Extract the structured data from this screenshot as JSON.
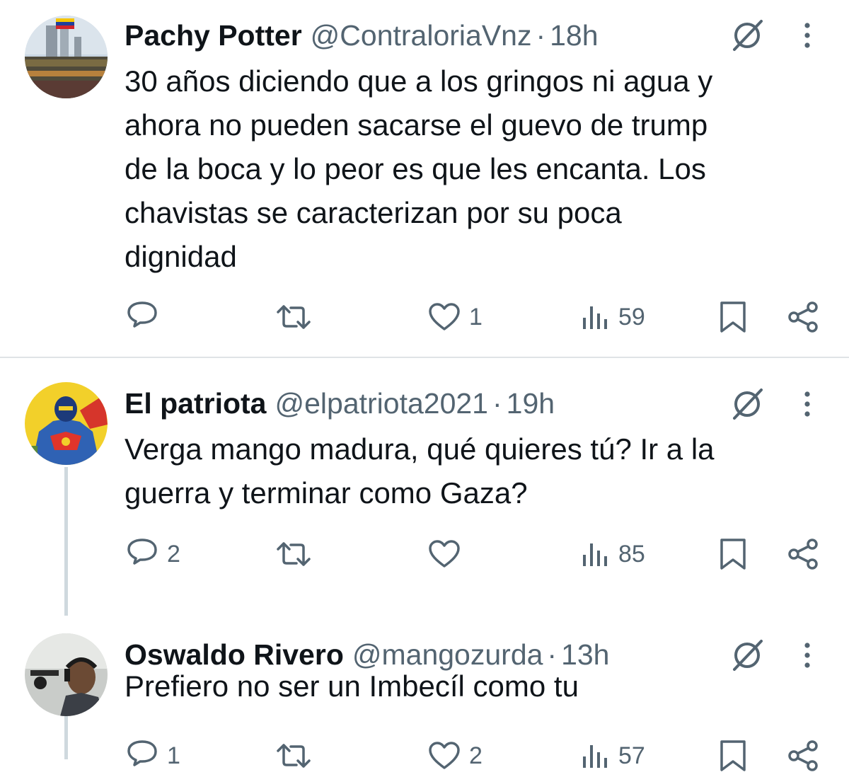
{
  "tweets": [
    {
      "display_name": "Pachy Potter",
      "handle": "@ContraloriaVnz",
      "separator": "·",
      "time": "18h",
      "text": "30 años diciendo que a los gringos ni agua y\nahora no pueden sacarse el guevo de  trump\nde la boca y lo peor es que les encanta. Los\nchavistas se caracterizan por su poca\ndignidad",
      "replies": "",
      "retweets": "",
      "likes": "1",
      "views": "59"
    },
    {
      "display_name": "El patriota",
      "handle": "@elpatriota2021",
      "separator": "·",
      "time": "19h",
      "text": "Verga mango madura, qué quieres tú? Ir a la\nguerra y terminar como Gaza?",
      "replies": "2",
      "retweets": "",
      "likes": "",
      "views": "85"
    },
    {
      "display_name": "Oswaldo Rivero",
      "handle": "@mangozurda",
      "separator": "·",
      "time": "13h",
      "text": "Prefiero no ser un Imbecíl como tu",
      "replies": "1",
      "retweets": "",
      "likes": "2",
      "views": "57"
    }
  ],
  "icons": {
    "grok": "grok-icon",
    "more": "more-vertical-icon",
    "reply": "reply-icon",
    "retweet": "retweet-icon",
    "like": "heart-icon",
    "views": "views-icon",
    "bookmark": "bookmark-icon",
    "share": "share-icon"
  },
  "colors": {
    "text_primary": "#0f1419",
    "text_secondary": "#536471",
    "divider": "#dfe3e6",
    "thread_line": "#cfd9de"
  }
}
